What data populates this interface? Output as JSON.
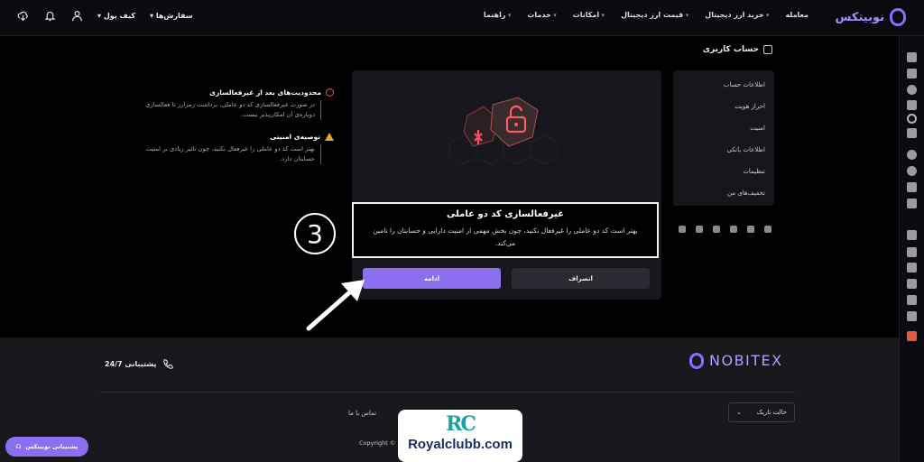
{
  "brand": {
    "name": "نوبیتکس"
  },
  "nav": {
    "items": [
      "معامله",
      "خرید ارز دیجیتال",
      "قیمت ارز دیجیتال",
      "امکانات",
      "خدمات",
      "راهنما"
    ],
    "orders": "سفارش‌ها",
    "wallet": "کیف پول"
  },
  "account": {
    "title": "حساب کاربری",
    "menu": [
      "اطلاعات حساب",
      "احراز هویت",
      "امنیت",
      "اطلاعات بانکی",
      "تنظیمات",
      "تخفیف‌های من"
    ]
  },
  "modal": {
    "title": "غیرفعالسازی کد دو عاملی",
    "body": "بهتر است کد دو عاملی را غیرفعال نکنید، چون بخش مهمی از امنیت دارایی و حسابتان را تامین می‌کند.",
    "continue": "ادامه",
    "cancel": "انصراف"
  },
  "tips": [
    {
      "title": "محدودیت‌های بعد از غیرفعالسازی",
      "text": "در صورت غیرفعالسازی کد دو عاملی، برداشت رمزارز تا فعالسازی دوباره‌ی آن امکان‌پذیر نیست."
    },
    {
      "title": "توصیه‌ی امنیتی",
      "text": "بهتر است کد دو عاملی را غیرفعال نکنید، چون تاثیر زیادی بر امنیت حسابتان دارد."
    }
  ],
  "step_number": "3",
  "footer": {
    "logo": "NOBITEX",
    "support": "پشتیبانی 24/7",
    "theme": "حالت تاریک",
    "contact": "تماس با ما",
    "copyright": "Copyright © 20"
  },
  "chat_button": "پشتیبانی نوبیتکس",
  "watermark": {
    "mark": "RC",
    "text": "Royalclubb.com"
  },
  "colors": {
    "accent": "#8b6ff0",
    "danger": "#e25b45",
    "warning": "#e8a52a"
  }
}
